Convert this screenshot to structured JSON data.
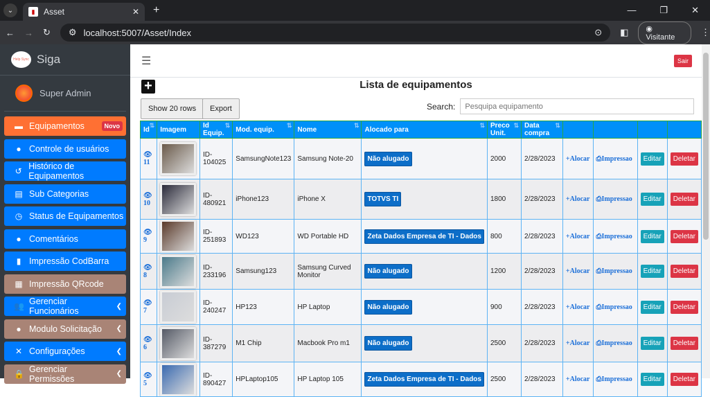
{
  "browser": {
    "tab_title": "Asset",
    "url": "localhost:5007/Asset/Index",
    "guest": "Visitante"
  },
  "sidebar": {
    "brand": "Siga",
    "logo_text": "Help Sync",
    "user": "Super Admin",
    "items": [
      {
        "label": "Equipamentos",
        "icon": "box-icon",
        "color": "#ff7033",
        "badge": "Novo"
      },
      {
        "label": "Controle de usuários",
        "icon": "users-icon",
        "color": "#007bff"
      },
      {
        "label": "Histórico de Equipamentos",
        "icon": "history-icon",
        "color": "#007bff"
      },
      {
        "label": "Sub Categorias",
        "icon": "list-icon",
        "color": "#007bff"
      },
      {
        "label": "Status de Equipamentos",
        "icon": "clock-icon",
        "color": "#007bff"
      },
      {
        "label": "Comentários",
        "icon": "comment-icon",
        "color": "#007bff"
      },
      {
        "label": "Impressão CodBarra",
        "icon": "barcode-icon",
        "color": "#007bff"
      },
      {
        "label": "Impressão QRcode",
        "icon": "qrcode-icon",
        "color": "#a98476"
      },
      {
        "label": "Gerenciar Funcionários",
        "icon": "group-icon",
        "color": "#007bff",
        "chevron": true
      },
      {
        "label": "Modulo Solicitação",
        "icon": "user-icon",
        "color": "#a98476",
        "chevron": true
      },
      {
        "label": "Configurações",
        "icon": "tools-icon",
        "color": "#007bff",
        "chevron": true
      },
      {
        "label": "Gerenciar Permissões",
        "icon": "lock-icon",
        "color": "#a98476",
        "chevron": true
      }
    ]
  },
  "header": {
    "logout": "Sair"
  },
  "page": {
    "title": "Lista de equipamentos",
    "show_rows": "Show 20 rows",
    "export": "Export",
    "search_label": "Search:",
    "search_placeholder": "Pesquipa equipamento"
  },
  "table": {
    "headers": [
      "Id",
      "Imagem",
      "Id Equip.",
      "Mod. equip.",
      "Nome",
      "Alocado para",
      "Preco Unit.",
      "Data compra",
      "",
      "",
      "",
      ""
    ],
    "actions": {
      "alocar": "+Alocar",
      "impressao": "Impressao",
      "editar": "Editar",
      "deletar": "Deletar"
    },
    "rows": [
      {
        "id": "11",
        "equip": "ID-104025",
        "model": "SamsungNote123",
        "name": "Samsung Note-20",
        "alloc": "Não alugado",
        "price": "2000",
        "date": "2/28/2023",
        "img": "#6a5a4a"
      },
      {
        "id": "10",
        "equip": "ID-480921",
        "model": "iPhone123",
        "name": "iPhone X",
        "alloc": "TOTVS TI",
        "price": "1800",
        "date": "2/28/2023",
        "img": "#2a2a3a"
      },
      {
        "id": "9",
        "equip": "ID-251893",
        "model": "WD123",
        "name": "WD Portable HD",
        "alloc": "Zeta Dados Empresa de TI - Dados",
        "price": "800",
        "date": "2/28/2023",
        "img": "#5a3a2a"
      },
      {
        "id": "8",
        "equip": "ID-233196",
        "model": "Samsung123",
        "name": "Samsung Curved Monitor",
        "alloc": "Não alugado",
        "price": "1200",
        "date": "2/28/2023",
        "img": "#4a7a8a"
      },
      {
        "id": "7",
        "equip": "ID-240247",
        "model": "HP123",
        "name": "HP Laptop",
        "alloc": "Não alugado",
        "price": "900",
        "date": "2/28/2023",
        "img": "#c8ccd4"
      },
      {
        "id": "6",
        "equip": "ID-387279",
        "model": "M1 Chip",
        "name": "Macbook Pro m1",
        "alloc": "Não alugado",
        "price": "2500",
        "date": "2/28/2023",
        "img": "#555a66"
      },
      {
        "id": "5",
        "equip": "ID-890427",
        "model": "HPLaptop105",
        "name": "HP Laptop 105",
        "alloc": "Zeta Dados Empresa de TI - Dados",
        "price": "2500",
        "date": "2/28/2023",
        "img": "#3a6ab0"
      }
    ]
  }
}
